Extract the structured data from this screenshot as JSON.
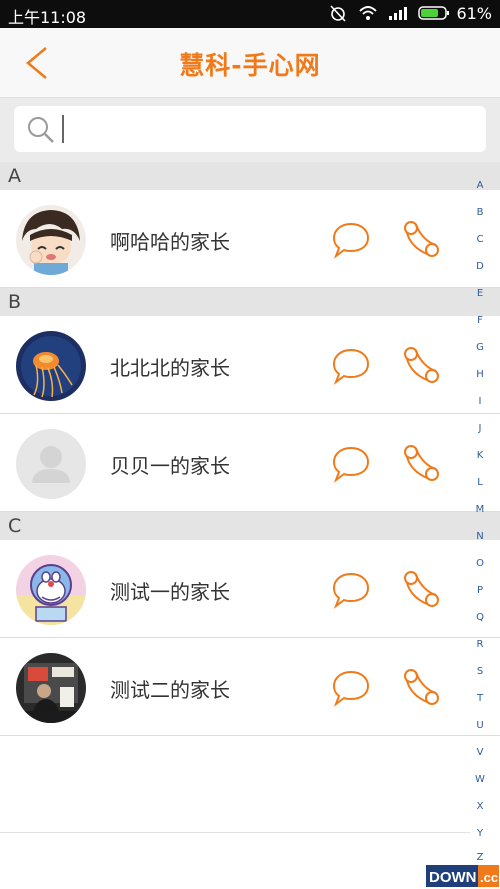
{
  "status_bar": {
    "time": "上午11:08",
    "battery": "61%"
  },
  "header": {
    "title": "慧科-手心网"
  },
  "search": {
    "placeholder": ""
  },
  "sections": [
    {
      "letter": "A",
      "contacts": [
        {
          "name": "啊哈哈的家长",
          "avatar": "cartoon-boy-avatar"
        }
      ]
    },
    {
      "letter": "B",
      "contacts": [
        {
          "name": "北北北的家长",
          "avatar": "jellyfish-avatar"
        },
        {
          "name": "贝贝一的家长",
          "avatar": "default-avatar"
        }
      ]
    },
    {
      "letter": "C",
      "contacts": [
        {
          "name": "测试一的家长",
          "avatar": "doraemon-avatar"
        },
        {
          "name": "测试二的家长",
          "avatar": "photo-avatar"
        }
      ]
    }
  ],
  "index_letters": [
    "A",
    "B",
    "C",
    "D",
    "E",
    "F",
    "G",
    "H",
    "I",
    "J",
    "K",
    "L",
    "M",
    "N",
    "O",
    "P",
    "Q",
    "R",
    "S",
    "T",
    "U",
    "V",
    "W",
    "X",
    "Y",
    "Z"
  ],
  "watermark": {
    "text": "DOWN.cc"
  },
  "colors": {
    "accent": "#f07a1a",
    "index": "#2d5c9a",
    "section_bg": "#e4e4e4"
  }
}
